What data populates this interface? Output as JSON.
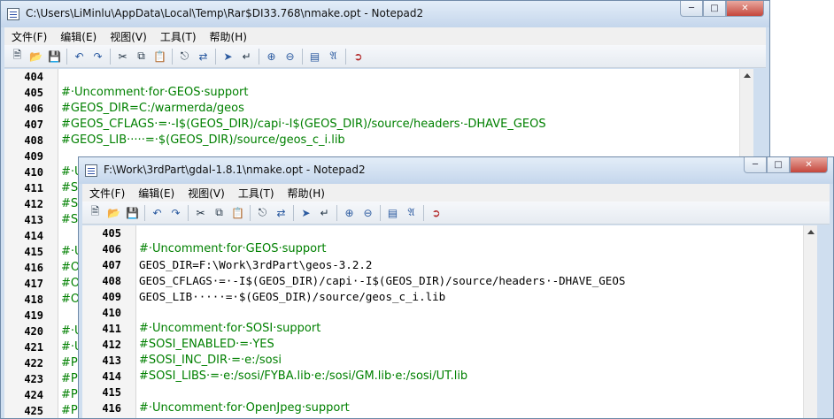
{
  "window1": {
    "title": "C:\\Users\\LiMinlu\\AppData\\Local\\Temp\\Rar$DI33.768\\nmake.opt - Notepad2",
    "menu": [
      "文件(F)",
      "编辑(E)",
      "视图(V)",
      "工具(T)",
      "帮助(H)"
    ],
    "lines": [
      {
        "n": "404",
        "text": "",
        "type": "normal"
      },
      {
        "n": "405",
        "text": "#·Uncomment·for·GEOS·support",
        "type": "comment"
      },
      {
        "n": "406",
        "text": "#GEOS_DIR=C:/warmerda/geos",
        "type": "comment"
      },
      {
        "n": "407",
        "text": "#GEOS_CFLAGS·=·-I$(GEOS_DIR)/capi·-I$(GEOS_DIR)/source/headers·-DHAVE_GEOS",
        "type": "comment"
      },
      {
        "n": "408",
        "text": "#GEOS_LIB·····=·$(GEOS_DIR)/source/geos_c_i.lib",
        "type": "comment"
      },
      {
        "n": "409",
        "text": "",
        "type": "normal"
      },
      {
        "n": "410",
        "text": "#·U",
        "type": "comment"
      },
      {
        "n": "411",
        "text": "#S",
        "type": "comment"
      },
      {
        "n": "412",
        "text": "#S",
        "type": "comment"
      },
      {
        "n": "413",
        "text": "#S",
        "type": "comment"
      },
      {
        "n": "414",
        "text": "",
        "type": "normal"
      },
      {
        "n": "415",
        "text": "#·U",
        "type": "comment"
      },
      {
        "n": "416",
        "text": "#O",
        "type": "comment"
      },
      {
        "n": "417",
        "text": "#O",
        "type": "comment"
      },
      {
        "n": "418",
        "text": "#O",
        "type": "comment"
      },
      {
        "n": "419",
        "text": "",
        "type": "normal"
      },
      {
        "n": "420",
        "text": "#·U",
        "type": "comment"
      },
      {
        "n": "421",
        "text": "#·U",
        "type": "comment"
      },
      {
        "n": "422",
        "text": "#PO",
        "type": "comment"
      },
      {
        "n": "423",
        "text": "#PO",
        "type": "comment"
      },
      {
        "n": "424",
        "text": "#PO",
        "type": "comment"
      },
      {
        "n": "425",
        "text": "#PO",
        "type": "comment"
      }
    ]
  },
  "window2": {
    "title": "F:\\Work\\3rdPart\\gdal-1.8.1\\nmake.opt - Notepad2",
    "menu": [
      "文件(F)",
      "编辑(E)",
      "视图(V)",
      "工具(T)",
      "帮助(H)"
    ],
    "lines": [
      {
        "n": "405",
        "text": "",
        "type": "normal"
      },
      {
        "n": "406",
        "text": "#·Uncomment·for·GEOS·support",
        "type": "comment"
      },
      {
        "n": "407",
        "text": "GEOS_DIR=F:\\Work\\3rdPart\\geos-3.2.2",
        "type": "normal"
      },
      {
        "n": "408",
        "text": "GEOS_CFLAGS·=·-I$(GEOS_DIR)/capi·-I$(GEOS_DIR)/source/headers·-DHAVE_GEOS",
        "type": "normal"
      },
      {
        "n": "409",
        "text": "GEOS_LIB·····=·$(GEOS_DIR)/source/geos_c_i.lib",
        "type": "normal"
      },
      {
        "n": "410",
        "text": "",
        "type": "normal"
      },
      {
        "n": "411",
        "text": "#·Uncomment·for·SOSI·support",
        "type": "comment"
      },
      {
        "n": "412",
        "text": "#SOSI_ENABLED·=·YES",
        "type": "comment"
      },
      {
        "n": "413",
        "text": "#SOSI_INC_DIR·=·e:/sosi",
        "type": "comment"
      },
      {
        "n": "414",
        "text": "#SOSI_LIBS·=·e:/sosi/FYBA.lib·e:/sosi/GM.lib·e:/sosi/UT.lib",
        "type": "comment"
      },
      {
        "n": "415",
        "text": "",
        "type": "normal"
      },
      {
        "n": "416",
        "text": "#·Uncomment·for·OpenJpeg·support",
        "type": "comment"
      }
    ]
  },
  "icons": [
    "new-file-icon",
    "open-file-icon",
    "save-icon",
    "undo-icon",
    "redo-icon",
    "cut-icon",
    "copy-icon",
    "paste-icon",
    "find-icon",
    "replace-icon",
    "goto-icon",
    "wordwrap-icon",
    "zoom-in-icon",
    "zoom-out-icon",
    "scheme-icon",
    "font-icon",
    "exit-icon"
  ]
}
